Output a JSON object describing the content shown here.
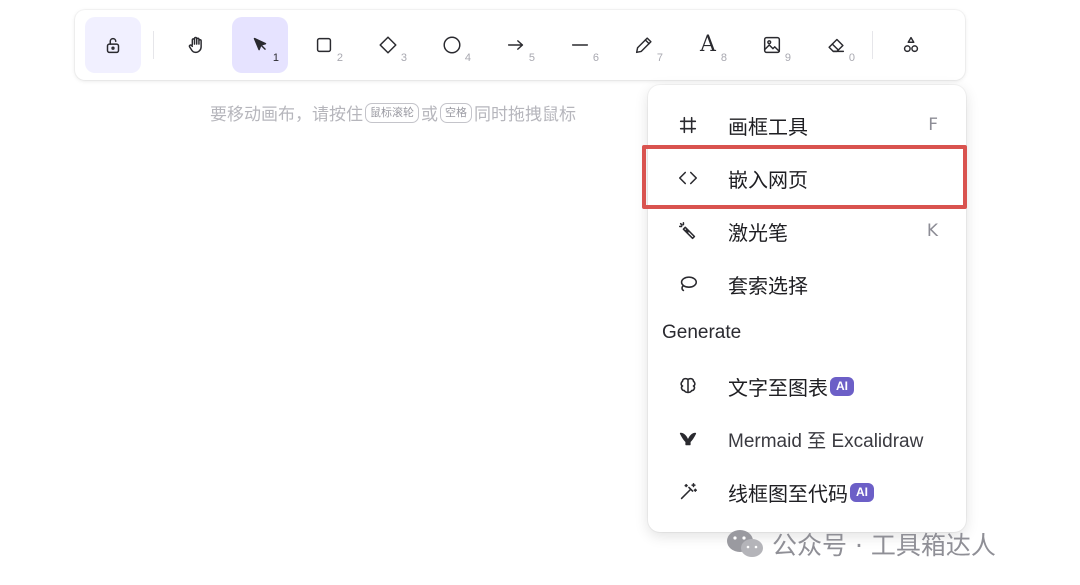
{
  "toolbar": {
    "tools": [
      {
        "name": "lock",
        "icon": "unlock-icon",
        "shortcut": ""
      },
      {
        "name": "hand",
        "icon": "hand-icon",
        "shortcut": ""
      },
      {
        "name": "selection",
        "icon": "pointer-icon",
        "shortcut": "1"
      },
      {
        "name": "rectangle",
        "icon": "square-icon",
        "shortcut": "2"
      },
      {
        "name": "diamond",
        "icon": "diamond-icon",
        "shortcut": "3"
      },
      {
        "name": "ellipse",
        "icon": "circle-icon",
        "shortcut": "4"
      },
      {
        "name": "arrow",
        "icon": "arrow-right-icon",
        "shortcut": "5"
      },
      {
        "name": "line",
        "icon": "line-icon",
        "shortcut": "6"
      },
      {
        "name": "draw",
        "icon": "pencil-icon",
        "shortcut": "7"
      },
      {
        "name": "text",
        "icon": "text-icon",
        "glyph": "A",
        "shortcut": "8"
      },
      {
        "name": "image",
        "icon": "image-icon",
        "shortcut": "9"
      },
      {
        "name": "eraser",
        "icon": "eraser-icon",
        "shortcut": "0"
      },
      {
        "name": "more-tools",
        "icon": "shapes-icon",
        "shortcut": ""
      }
    ],
    "active": "selection",
    "accent": "#e6e3ff"
  },
  "hint": {
    "part1": "要移动画布，请按住",
    "key1": "鼠标滚轮",
    "part2": "或",
    "key2": "空格",
    "part3": "同时拖拽鼠标"
  },
  "menu": {
    "items": [
      {
        "label": "画框工具",
        "shortcut": "F",
        "icon": "frame-icon"
      },
      {
        "label": "嵌入网页",
        "shortcut": "",
        "icon": "code-icon"
      },
      {
        "label": "激光笔",
        "shortcut": "K",
        "icon": "laser-pointer-icon"
      },
      {
        "label": "套索选择",
        "shortcut": "",
        "icon": "lasso-icon"
      }
    ],
    "section_title": "Generate",
    "generate_items": [
      {
        "label": "文字至图表",
        "badge": "AI",
        "icon": "brain-icon"
      },
      {
        "label": "Mermaid 至 Excalidraw",
        "badge": "",
        "icon": "mermaid-icon"
      },
      {
        "label": "线框图至代码",
        "badge": "AI",
        "icon": "magic-wand-icon"
      }
    ],
    "highlight_color": "#d9534f",
    "badge_color": "#6c5fc7"
  },
  "watermark": {
    "text": "公众号 · 工具箱达人"
  }
}
